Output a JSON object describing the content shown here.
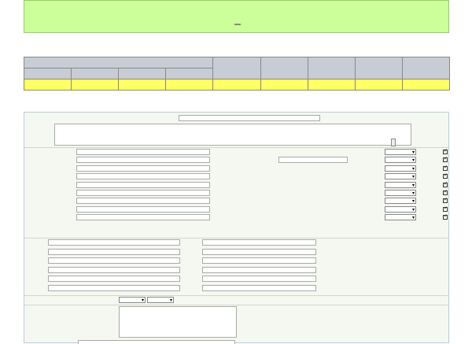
{
  "header": {
    "title": "",
    "contact_text": "",
    "link_text": "",
    "logout_label": ""
  },
  "form_title": "",
  "preview": {
    "group_header": "",
    "columns": [
      "",
      "",
      "",
      "",
      "",
      "",
      "",
      "",
      ""
    ],
    "right_headers": [
      "",
      "",
      "",
      "",
      ""
    ],
    "marks": [
      "",
      "",
      "",
      "",
      "",
      "",
      "",
      "",
      ""
    ]
  },
  "fill_note": "",
  "editor": {
    "table_name_label": "",
    "table_name_value": "",
    "textarea_value": "",
    "set_button": "",
    "formula_label": "",
    "formula_value": "",
    "fields": [
      {
        "label": "",
        "value": "",
        "attr": "",
        "show": ""
      },
      {
        "label": "",
        "value": "",
        "attr": "",
        "show": ""
      },
      {
        "label": "",
        "value": "",
        "attr": "",
        "show": ""
      },
      {
        "label": "",
        "value": "",
        "attr": "",
        "show": ""
      },
      {
        "label": "",
        "value": "",
        "attr": "",
        "show": ""
      },
      {
        "label": "",
        "value": "",
        "attr": "",
        "show": ""
      },
      {
        "label": "",
        "value": "",
        "attr": "",
        "show": ""
      },
      {
        "label": "",
        "value": "",
        "attr": "",
        "show": ""
      },
      {
        "label": "",
        "value": "",
        "attr": "",
        "show": ""
      }
    ],
    "instruction": {
      "part1": "",
      "part2": "",
      "part3": "",
      "part4": "",
      "part5": ""
    },
    "headers": [
      {
        "label": "",
        "value": "",
        "merge_label": "",
        "merge_value": ""
      },
      {
        "label": "",
        "value": "",
        "merge_label": "",
        "merge_value": ""
      },
      {
        "label": "",
        "value": "",
        "merge_label": "",
        "merge_value": ""
      },
      {
        "label": "",
        "value": "",
        "merge_label": "",
        "merge_value": ""
      },
      {
        "label": "",
        "value": "",
        "merge_label": "",
        "merge_value": ""
      },
      {
        "label": "",
        "value": "",
        "merge_label": "",
        "merge_value": ""
      }
    ],
    "status_label": "",
    "status_select1": "",
    "status_select2": "",
    "fill_note_label": ""
  }
}
